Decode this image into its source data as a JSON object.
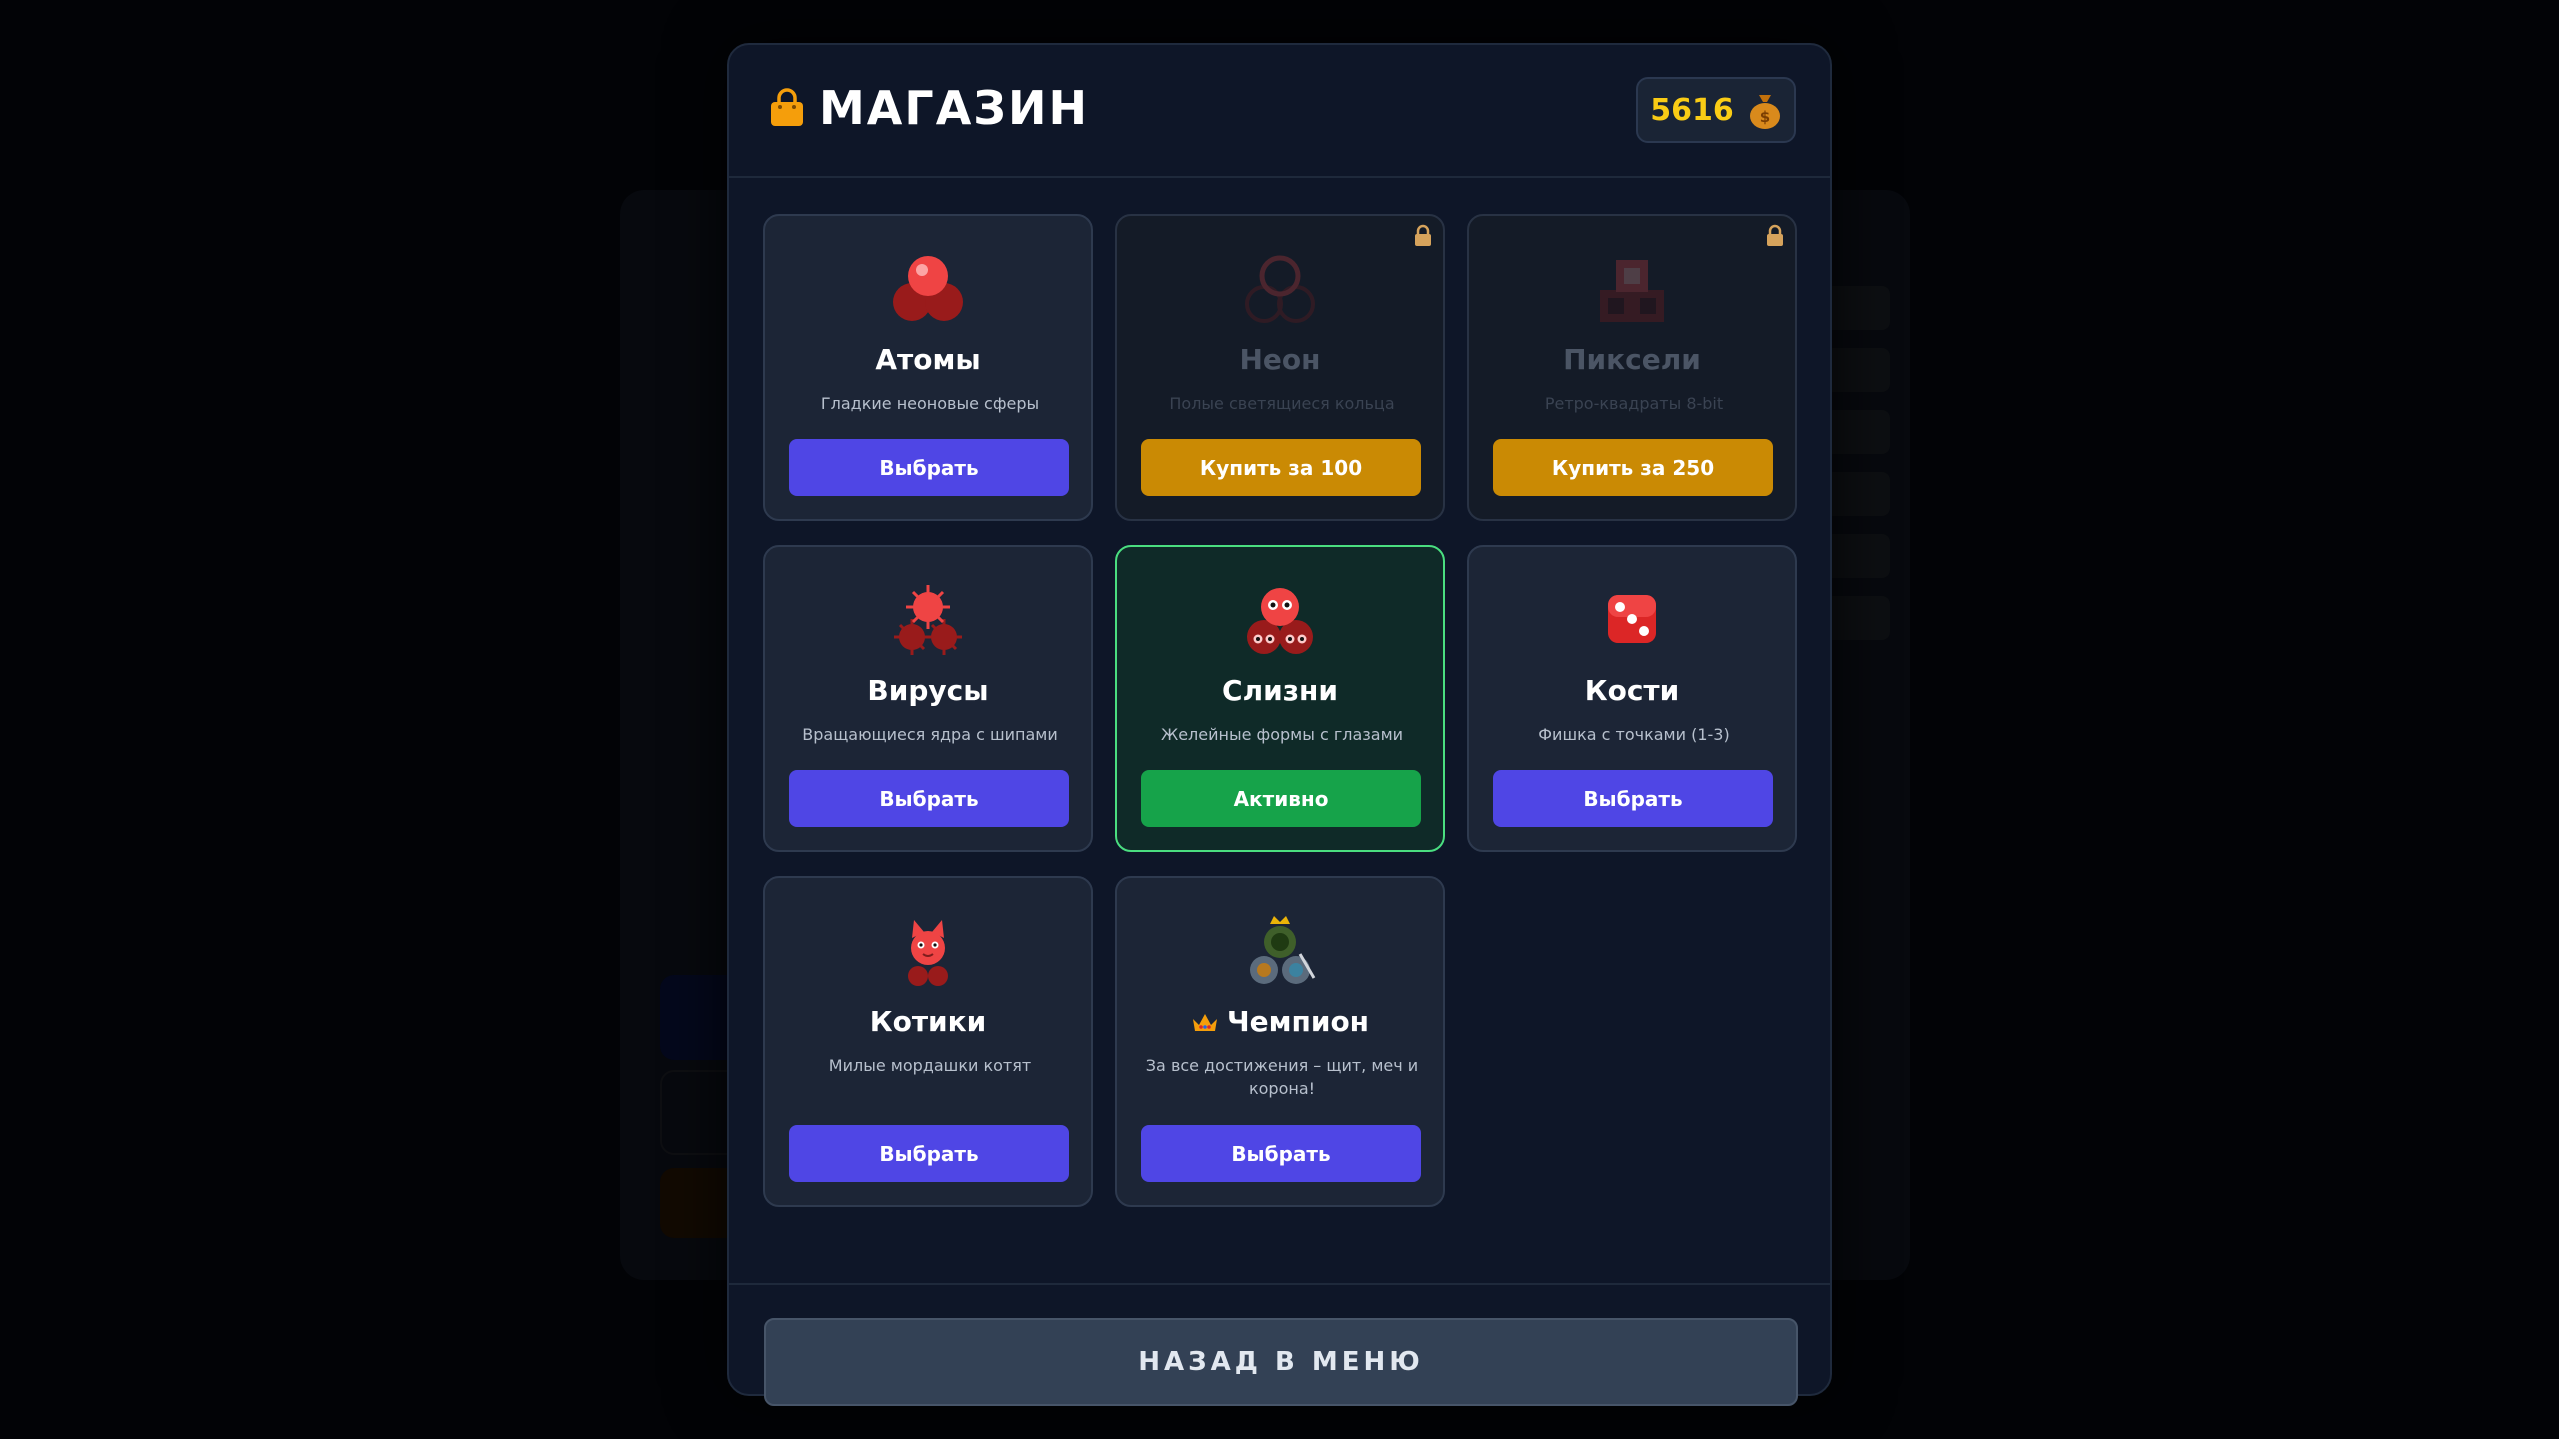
{
  "header": {
    "title": "МАГАЗИН",
    "icon": "shopping-bag-icon",
    "coins": "5616",
    "coins_icon": "money-bag-icon"
  },
  "skins": [
    {
      "name": "Атомы",
      "desc": "Гладкие неоновые сферы",
      "button": "Выбрать",
      "state": "owned",
      "icon": "atoms-icon"
    },
    {
      "name": "Неон",
      "desc": "Полые светящиеся кольца",
      "button": "Купить за 100",
      "state": "locked",
      "icon": "neon-rings-icon"
    },
    {
      "name": "Пиксели",
      "desc": "Ретро-квадраты 8-bit",
      "button": "Купить за 250",
      "state": "locked",
      "icon": "pixels-icon"
    },
    {
      "name": "Вирусы",
      "desc": "Вращающиеся ядра с шипами",
      "button": "Выбрать",
      "state": "owned",
      "icon": "virus-icon"
    },
    {
      "name": "Слизни",
      "desc": "Желейные формы с глазами",
      "button": "Активно",
      "state": "active",
      "icon": "slime-icon"
    },
    {
      "name": "Кости",
      "desc": "Фишка с точками (1-3)",
      "button": "Выбрать",
      "state": "owned",
      "icon": "dice-icon"
    },
    {
      "name": "Котики",
      "desc": "Милые мордашки котят",
      "button": "Выбрать",
      "state": "owned",
      "icon": "cat-icon"
    },
    {
      "name": "Чемпион",
      "desc": "За все достижения – щит, меч и корона!",
      "button": "Выбрать",
      "state": "owned",
      "icon": "champion-icon",
      "prefix_icon": "crown-icon"
    }
  ],
  "footer": {
    "back_label": "НАЗАД В МЕНЮ"
  },
  "colors": {
    "modal_bg": "#0e1628",
    "card_bg": "#1c2536",
    "select_button": "#4f46e5",
    "buy_button": "#ca8a04",
    "active_button": "#16a34a",
    "active_border": "#4ade80",
    "coins_text": "#facc15"
  }
}
